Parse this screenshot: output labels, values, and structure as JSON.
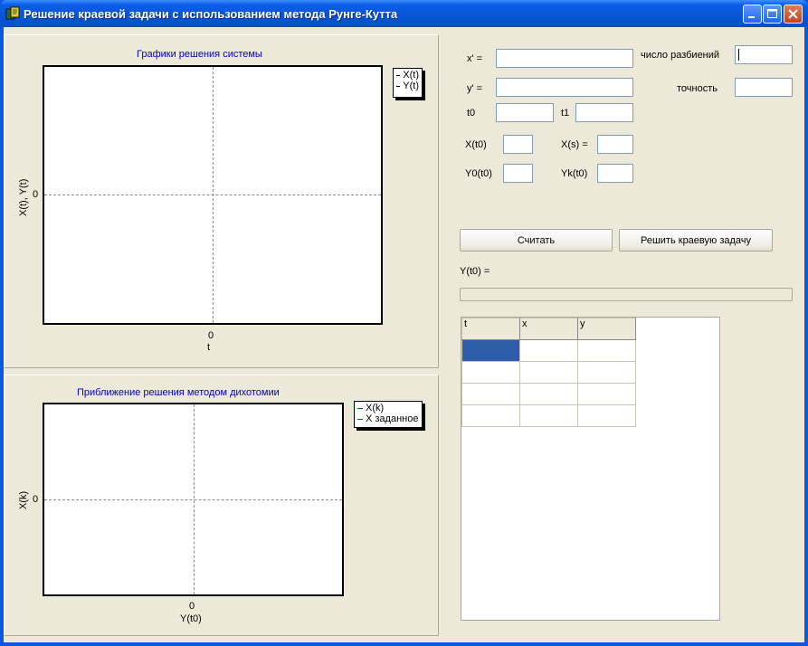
{
  "window": {
    "title": "Решение краевой задачи с использованием метода Рунге-Кутта",
    "colors": {
      "titlebar": "#0a5ee6",
      "face": "#ece9d8",
      "chart_title": "#0000c8",
      "selection": "#2f5ea8"
    }
  },
  "chart1": {
    "title": "Графики решения системы",
    "xlabel": "t",
    "ylabel": "X(t), Y(t)",
    "x_tick": "0",
    "y_tick": "0",
    "legend": [
      "X(t)",
      "Y(t)"
    ]
  },
  "chart2": {
    "title": "Приближение решения методом дихотомии",
    "xlabel": "Y(t0)",
    "ylabel": "X(k)",
    "x_tick": "0",
    "y_tick": "0",
    "legend": [
      {
        "label": "X(k)",
        "color": "#d00000"
      },
      {
        "label": "X заданное",
        "color": "#008000"
      }
    ]
  },
  "form": {
    "x_prime_label": "x' =",
    "y_prime_label": "y' =",
    "t0_label": "t0",
    "t1_label": "t1",
    "x_t0_label": "X(t0)",
    "y0_t0_label": "Y0(t0)",
    "x_s_label": "X(s) =",
    "yk_t0_label": "Yk(t0)",
    "partitions_label": "число разбиений",
    "accuracy_label": "точность",
    "calc_button": "Считать",
    "solve_button": "Решить краевую задачу",
    "y_t0_result_label": "Y(t0) ="
  },
  "table": {
    "headers": [
      "t",
      "x",
      "y"
    ],
    "rows": [
      [
        "",
        "",
        ""
      ],
      [
        "",
        "",
        ""
      ],
      [
        "",
        "",
        ""
      ],
      [
        "",
        "",
        ""
      ]
    ]
  }
}
